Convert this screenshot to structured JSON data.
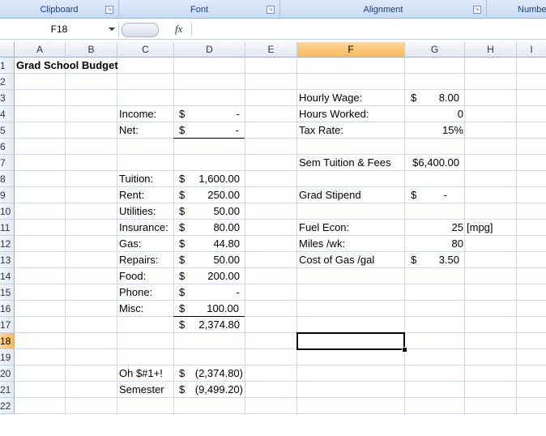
{
  "ribbon": {
    "groups": [
      "Clipboard",
      "Font",
      "Alignment",
      "Numbe"
    ]
  },
  "formula_bar": {
    "name_box": "F18",
    "fx_label": "fx",
    "formula": ""
  },
  "columns": [
    "A",
    "B",
    "C",
    "D",
    "E",
    "F",
    "G",
    "H",
    "I"
  ],
  "rows": [
    "1",
    "2",
    "3",
    "4",
    "5",
    "6",
    "7",
    "8",
    "9",
    "10",
    "11",
    "12",
    "13",
    "14",
    "15",
    "16",
    "17",
    "18",
    "19",
    "20",
    "21",
    "22"
  ],
  "sheet": {
    "title": "Grad School Budget",
    "income_label": "Income:",
    "net_label": "Net:",
    "expenses": [
      {
        "label": "Tuition:",
        "cur": "$",
        "value": "1,600.00"
      },
      {
        "label": "Rent:",
        "cur": "$",
        "value": "250.00"
      },
      {
        "label": "Utilities:",
        "cur": "$",
        "value": "50.00"
      },
      {
        "label": "Insurance:",
        "cur": "$",
        "value": "80.00"
      },
      {
        "label": "Gas:",
        "cur": "$",
        "value": "44.80"
      },
      {
        "label": "Repairs:",
        "cur": "$",
        "value": "50.00"
      },
      {
        "label": "Food:",
        "cur": "$",
        "value": "200.00"
      },
      {
        "label": "Phone:",
        "cur": "$",
        "value": "-"
      },
      {
        "label": "Misc:",
        "cur": "$",
        "value": "100.00"
      }
    ],
    "income_cur": "$",
    "income_value": "-",
    "net_cur": "$",
    "net_value": "-",
    "total_cur": "$",
    "total_value": "2,374.80",
    "oh_label": "Oh $#1+!",
    "oh_cur": "$",
    "oh_value": "(2,374.80)",
    "sem_label": "Semester",
    "sem_cur": "$",
    "sem_value": "(9,499.20)",
    "hourly_label": "Hourly Wage:",
    "hourly_cur": "$",
    "hourly_value": "8.00",
    "hours_label": "Hours Worked:",
    "hours_value": "0",
    "tax_label": "Tax Rate:",
    "tax_value": "15%",
    "tuition_fees_label": "Sem Tuition & Fees",
    "tuition_fees_value": "$6,400.00",
    "stipend_label": "Grad Stipend",
    "stipend_cur": "$",
    "stipend_value": "-",
    "fuel_label": "Fuel Econ:",
    "fuel_value": "25",
    "fuel_unit": "[mpg]",
    "miles_label": "Miles /wk:",
    "miles_value": "80",
    "gascost_label": "Cost of Gas /gal",
    "gascost_cur": "$",
    "gascost_value": "3.50"
  }
}
